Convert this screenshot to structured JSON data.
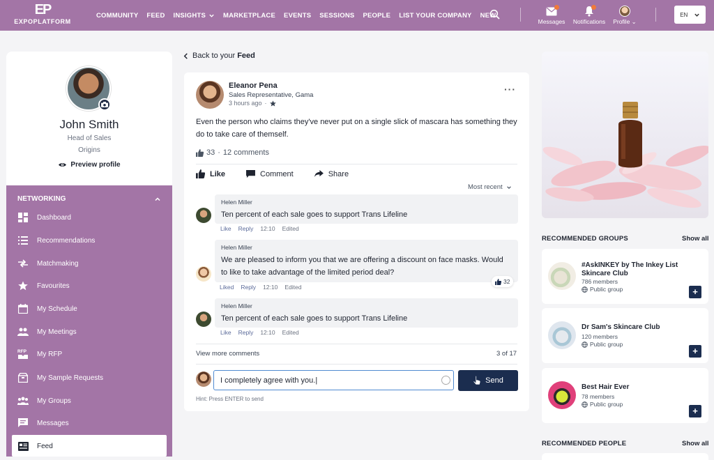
{
  "brand": {
    "mark": "EP",
    "name": "EXPOPLATFORM"
  },
  "nav": {
    "items": [
      "COMMUNITY",
      "FEED",
      "INSIGHTS",
      "MARKETPLACE",
      "EVENTS",
      "SESSIONS",
      "PEOPLE",
      "LIST YOUR COMPANY",
      "NEW"
    ],
    "messages_label": "Messages",
    "notifications_label": "Notifications",
    "profile_label": "Profile",
    "messages_badge": "1",
    "notifications_badge": "1",
    "language": "EN"
  },
  "profile": {
    "name": "John Smith",
    "role": "Head of Sales",
    "org": "Origins",
    "preview_label": "Preview profile"
  },
  "sidebar": {
    "section": "NETWORKING",
    "items": [
      {
        "label": "Dashboard",
        "icon": "dashboard-icon"
      },
      {
        "label": "Recommendations",
        "icon": "list-icon"
      },
      {
        "label": "Matchmaking",
        "icon": "arrows-icon"
      },
      {
        "label": "Favourites",
        "icon": "star-icon"
      },
      {
        "label": "My Schedule",
        "icon": "calendar-icon"
      },
      {
        "label": "My Meetings",
        "icon": "people-icon"
      },
      {
        "label": "My RFP",
        "icon": "rfp-icon"
      },
      {
        "label": "My Sample Requests",
        "icon": "box-icon"
      },
      {
        "label": "My Groups",
        "icon": "group-icon"
      },
      {
        "label": "Messages",
        "icon": "chat-icon"
      },
      {
        "label": "Feed",
        "icon": "feed-icon"
      }
    ],
    "active": "Feed"
  },
  "feed": {
    "back_prefix": "Back to your ",
    "back_strong": "Feed",
    "post": {
      "author": "Eleanor Pena",
      "author_title": "Sales Representative, Gama",
      "time": "3 hours ago",
      "text": "Even the person who claims they've never put on a single slick of mascara has something they do to take care of themself.",
      "likes": "33",
      "comments_label": "12 comments",
      "actions": {
        "like": "Like",
        "comment": "Comment",
        "share": "Share"
      },
      "sort_label": "Most recent"
    },
    "comments": [
      {
        "author": "Helen Miller",
        "text": "Ten percent of each sale goes to support Trans Lifeline",
        "like": "Like",
        "reply": "Reply",
        "time": "12:10",
        "edited": "Edited"
      },
      {
        "author": "Helen Miller",
        "text": "We are pleased to inform you that we are offering a discount on face masks. Would to like to take advantage of the limited period deal?",
        "like": "Liked",
        "reply": "Reply",
        "time": "12:10",
        "edited": "Edited",
        "likes": "32"
      },
      {
        "author": "Helen Miller",
        "text": "Ten percent of each sale goes to support Trans Lifeline",
        "like": "Like",
        "reply": "Reply",
        "time": "12:10",
        "edited": "Edited"
      }
    ],
    "view_more": "View more comments",
    "count": "3 of 17",
    "reply_value": "I completely agree with you.|",
    "send_label": "Send",
    "hint": "Hint: Press ENTER to send"
  },
  "right": {
    "groups_title": "RECOMMENDED GROUPS",
    "show_all": "Show all",
    "groups": [
      {
        "name": "#AskINKEY by The Inkey List Skincare Club",
        "members": "786 members",
        "type": "Public group"
      },
      {
        "name": "Dr Sam's Skincare Club",
        "members": "120 members",
        "type": "Public group"
      },
      {
        "name": "Best Hair Ever",
        "members": "78 members",
        "type": "Public group"
      }
    ],
    "people_title": "RECOMMENDED  PEOPLE",
    "people_show_all": "Show all"
  },
  "colors": {
    "topbar": "#a375a6",
    "sidebar": "#a375a6",
    "primary": "#1b2d4f",
    "link": "#5b6b9a"
  }
}
